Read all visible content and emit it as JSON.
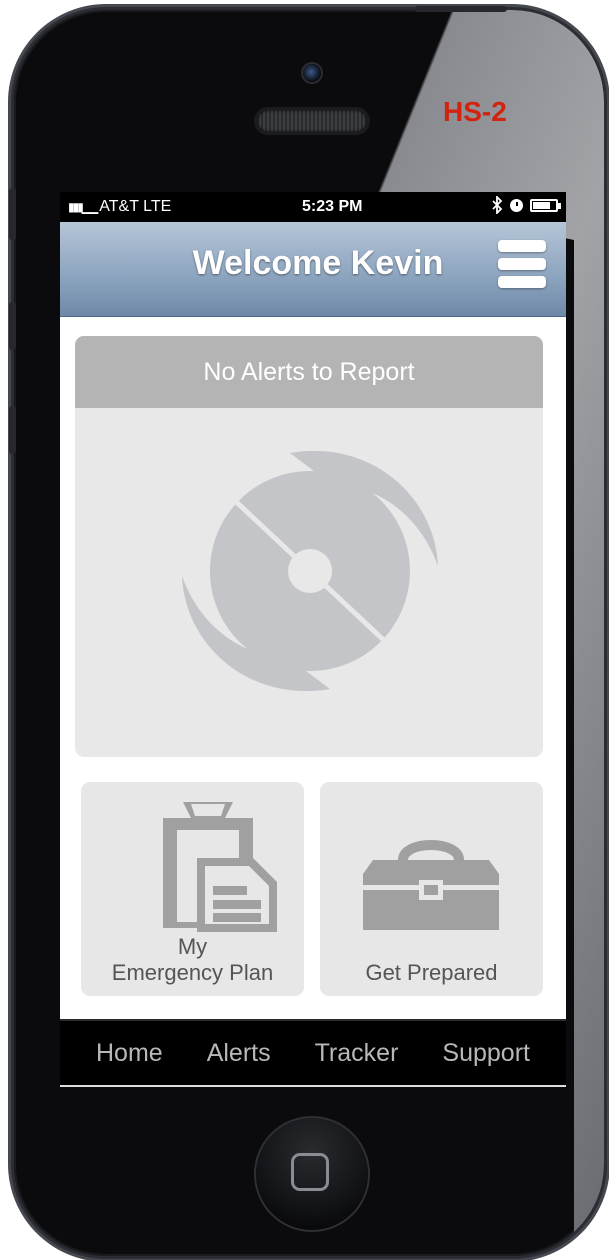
{
  "device_tag": "HS-2",
  "status_bar": {
    "carrier": "AT&T LTE",
    "time": "5:23 PM"
  },
  "header": {
    "title": "Welcome Kevin"
  },
  "alert_panel": {
    "status_text": "No Alerts to Report"
  },
  "tiles": [
    {
      "label_line1": "My",
      "label_line2": "Emergency Plan",
      "icon": "clipboard-document-icon"
    },
    {
      "label": "Get Prepared",
      "icon": "toolbox-icon"
    }
  ],
  "tabbar": {
    "items": [
      "Home",
      "Alerts",
      "Tracker",
      "Support"
    ]
  },
  "colors": {
    "tag_red": "#d2230f",
    "header_blue": "#8ea6c0",
    "panel_gray": "#e8e8e8",
    "alert_header_gray": "#b4b4b4"
  }
}
